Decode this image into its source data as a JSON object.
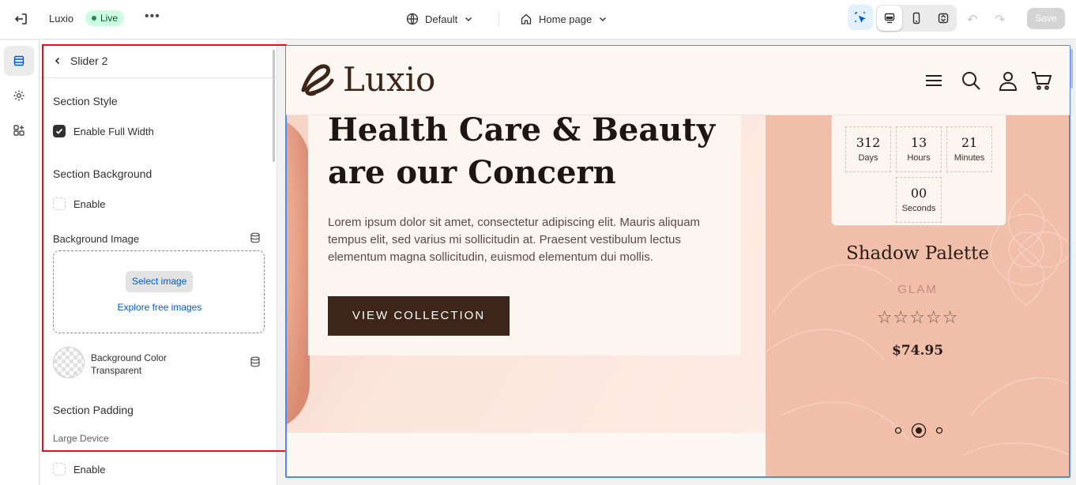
{
  "topbar": {
    "store_name": "Luxio",
    "status": "Live",
    "more": "•••",
    "theme": "Default",
    "page": "Home page",
    "save_label": "Save"
  },
  "panel": {
    "title": "Slider 2",
    "section_style": {
      "title": "Section Style",
      "full_width_label": "Enable Full Width",
      "full_width_checked": true
    },
    "section_background": {
      "title": "Section Background",
      "enable_label": "Enable",
      "enable_checked": false,
      "bg_image_label": "Background Image",
      "select_image": "Select image",
      "explore_images": "Explore free images",
      "bg_color_label": "Background Color",
      "bg_color_value": "Transparent"
    },
    "section_padding": {
      "title": "Section Padding",
      "device": "Large Device",
      "enable_label": "Enable",
      "enable_checked": false
    }
  },
  "preview": {
    "logo": "Luxio",
    "headline_line1": "Health Care & Beauty",
    "headline_line2": "are our Concern",
    "body": "Lorem ipsum dolor sit amet, consectetur adipiscing elit. Mauris aliquam tempus elit, sed varius mi sollicitudin at. Praesent vestibulum lectus elementum magna sollicitudin, euismod elementum dui mollis.",
    "cta": "VIEW COLLECTION",
    "countdown": [
      {
        "value": "312",
        "label": "Days"
      },
      {
        "value": "13",
        "label": "Hours"
      },
      {
        "value": "21",
        "label": "Minutes"
      },
      {
        "value": "00",
        "label": "Seconds"
      }
    ],
    "product_name": "Shadow Palette",
    "product_brand": "GLAM",
    "stars": "☆☆☆☆☆",
    "price": "$74.95",
    "slider_active_index": 1
  },
  "colors": {
    "brand_dark": "#3d2519",
    "highlight": "#e3101f",
    "preview_border": "#4c8bf5",
    "live_badge": "#cdfee1"
  }
}
